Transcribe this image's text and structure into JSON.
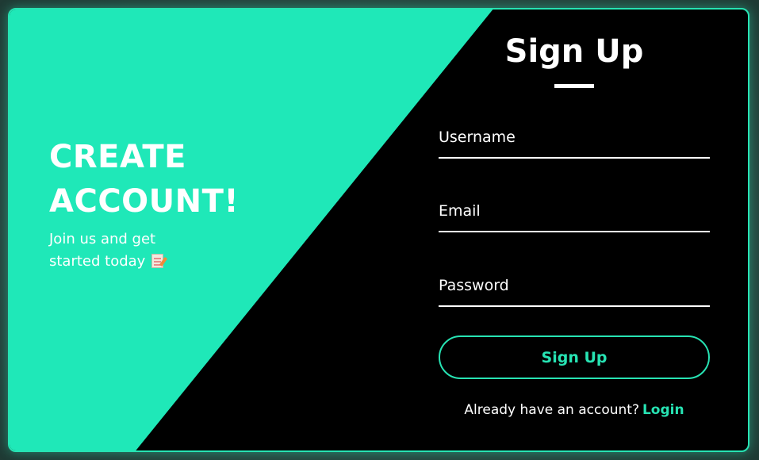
{
  "colors": {
    "accent": "#27e3b3",
    "panel_left": "#1fe8b8",
    "panel_right": "#000000",
    "text": "#ffffff"
  },
  "welcome": {
    "heading": "CREATE ACCOUNT!",
    "subtext": "Join us and get started today",
    "icon": "memo-icon"
  },
  "form": {
    "title": "Sign Up",
    "fields": [
      {
        "label": "Username"
      },
      {
        "label": "Email"
      },
      {
        "label": "Password"
      }
    ],
    "submit_label": "Sign Up",
    "footer_text": "Already have an account?",
    "footer_link": "Login"
  }
}
